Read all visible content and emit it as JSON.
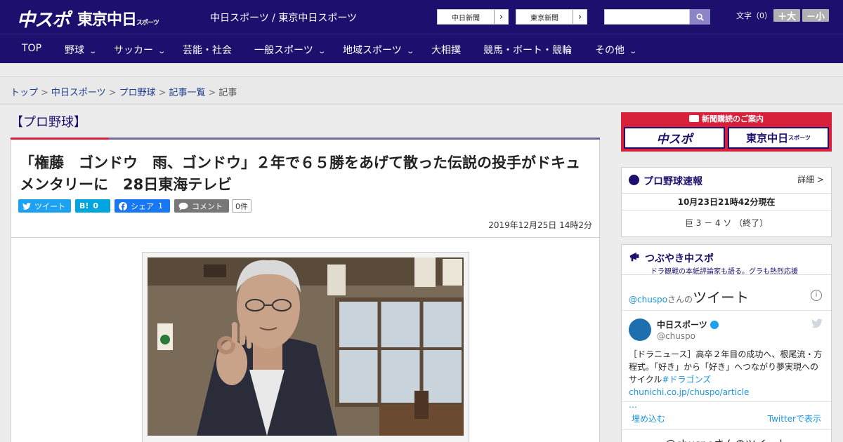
{
  "header": {
    "logo_main": "中スポ",
    "logo_tokyo": "東京中日",
    "logo_tokyo_small": "スポーツ",
    "site_subtitle": "中日スポーツ / 東京中日スポーツ",
    "ext_links": [
      "中日新聞",
      "東京新聞"
    ],
    "search_placeholder": "",
    "font_size_label": "文字（0）",
    "font_larger": "＋大",
    "font_smaller": "－小"
  },
  "nav": {
    "items": [
      {
        "label": "TOP",
        "has_menu": false
      },
      {
        "label": "野球",
        "has_menu": true
      },
      {
        "label": "サッカー",
        "has_menu": true
      },
      {
        "label": "芸能・社会",
        "has_menu": false
      },
      {
        "label": "一般スポーツ",
        "has_menu": true
      },
      {
        "label": "地域スポーツ",
        "has_menu": true
      },
      {
        "label": "大相撲",
        "has_menu": false
      },
      {
        "label": "競馬・ボート・競輪",
        "has_menu": false
      },
      {
        "label": "その他",
        "has_menu": true
      }
    ]
  },
  "breadcrumb": {
    "items": [
      "トップ",
      "中日スポーツ",
      "プロ野球",
      "記事一覧"
    ],
    "current": "記事"
  },
  "category": "【プロ野球】",
  "article": {
    "headline": "「権藤　ゴンドウ　雨、ゴンドウ」２年で６５勝をあげて散った伝説の投手がドキュメンタリーに　28日東海テレビ",
    "share": {
      "tweet": "ツイート",
      "hatena": "B!",
      "hatena_count": "0",
      "facebook": "シェア",
      "facebook_count": "1",
      "comment": "コメント",
      "comment_count": "0件"
    },
    "date": "2019年12月25日 14時2分"
  },
  "sidebar": {
    "ad_text": "新聞購読のご案内",
    "ad_logo_left": "中スポ",
    "ad_logo_right": "東京中日",
    "ad_logo_right_small": "スポーツ",
    "baseball": {
      "title": "プロ野球速報",
      "more": "詳細 >",
      "updated": "10月23日21時42分現在",
      "score": "巨 3 － 4 ソ （終了）"
    },
    "twitter": {
      "title": "つぶやき中スポ",
      "subtitle": "ドラ観戦の本紙評論家も語る。グラも熱烈応援",
      "header_handle": "@chuspo",
      "header_suffix": "さんの",
      "header_label": "ツイート",
      "account_name": "中日スポーツ",
      "account_handle": "@chuspo",
      "tweet_text": "［ドラニュース］高卒２年目の成功へ、根尾流・方程式。「好き」から「好き」へつながり夢実現へのサイクル",
      "tweet_hashtag": "#ドラゴンズ",
      "tweet_link": "chunichi.co.jp/chuspo/article",
      "tweet_ellipsis": "…",
      "embed": "埋め込む",
      "view_on_twitter": "Twitterで表示",
      "footer_text": "@chuspoさんのツイート"
    }
  },
  "colors": {
    "brand_navy": "#1d0f6d",
    "accent_red": "#d8203a",
    "twitter_blue": "#1da1f2",
    "hatena_blue": "#00a4de",
    "facebook_blue": "#1877f2"
  }
}
